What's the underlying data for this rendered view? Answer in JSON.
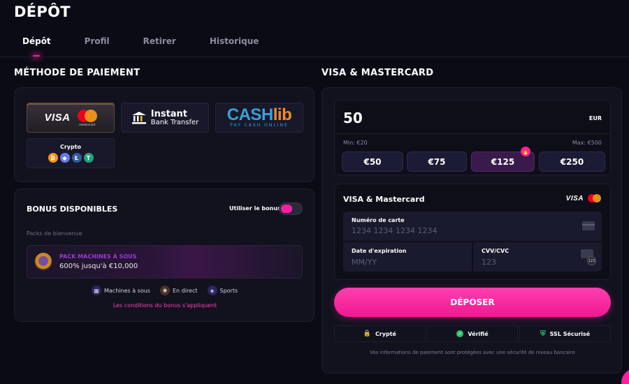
{
  "header": {
    "title": "DÉPÔT",
    "tabs": [
      {
        "label": "Dépôt",
        "active": true
      },
      {
        "label": "Profil",
        "active": false
      },
      {
        "label": "Retirer",
        "active": false
      },
      {
        "label": "Historique",
        "active": false
      }
    ]
  },
  "payment_methods": {
    "title": "MÉTHODE DE PAIEMENT",
    "visa": {
      "visa_text": "VISA",
      "mc_text": "mastercard",
      "selected": true
    },
    "bank": {
      "line1": "Instant",
      "line2": "Bank Transfer"
    },
    "cashlib": {
      "brand_a": "CASH",
      "brand_b": "lib",
      "tagline": "PAY CASH ONLINE"
    },
    "crypto": {
      "label": "Crypto",
      "coins": [
        "bitcoin-icon",
        "ethereum-icon",
        "litecoin-icon",
        "tether-icon"
      ]
    }
  },
  "bonus": {
    "title": "BONUS DISPONIBLES",
    "toggle_label": "Utiliser le bonus",
    "toggle_on": true,
    "subtitle": "Packs de bienvenue",
    "pack_title": "PACK MACHINES À SOUS",
    "pack_desc": "600% jusqu'à €10,000",
    "categories": [
      "Machines à sous",
      "En direct",
      "Sports"
    ],
    "conditions": "Les conditions du bonus s'appliquent"
  },
  "deposit": {
    "title": "VISA & MASTERCARD",
    "amount": "50",
    "currency": "EUR",
    "min": "Min: €20",
    "max": "Max: €500",
    "presets": [
      "€50",
      "€75",
      "€125",
      "€250"
    ],
    "popular_index": 2,
    "card_section_title": "VISA & Mastercard",
    "card_visa": "VISA",
    "card_number_label": "Numéro de carte",
    "card_number_placeholder": "1234 1234 1234 1234",
    "expiry_label": "Date d'expiration",
    "expiry_placeholder": "MM/YY",
    "cvv_label": "CVV/CVC",
    "cvv_placeholder": "123",
    "cvv_badge": "123",
    "submit": "DÉPOSER",
    "trust": [
      "Crypté",
      "Vérifié",
      "SSL Sécurisé"
    ],
    "footer": "Vos informations de paiement sont protégées avec une sécurité de niveau bancaire"
  },
  "colors": {
    "accent": "#ff1ea0",
    "background": "#0b0b16",
    "card": "#12121f"
  }
}
